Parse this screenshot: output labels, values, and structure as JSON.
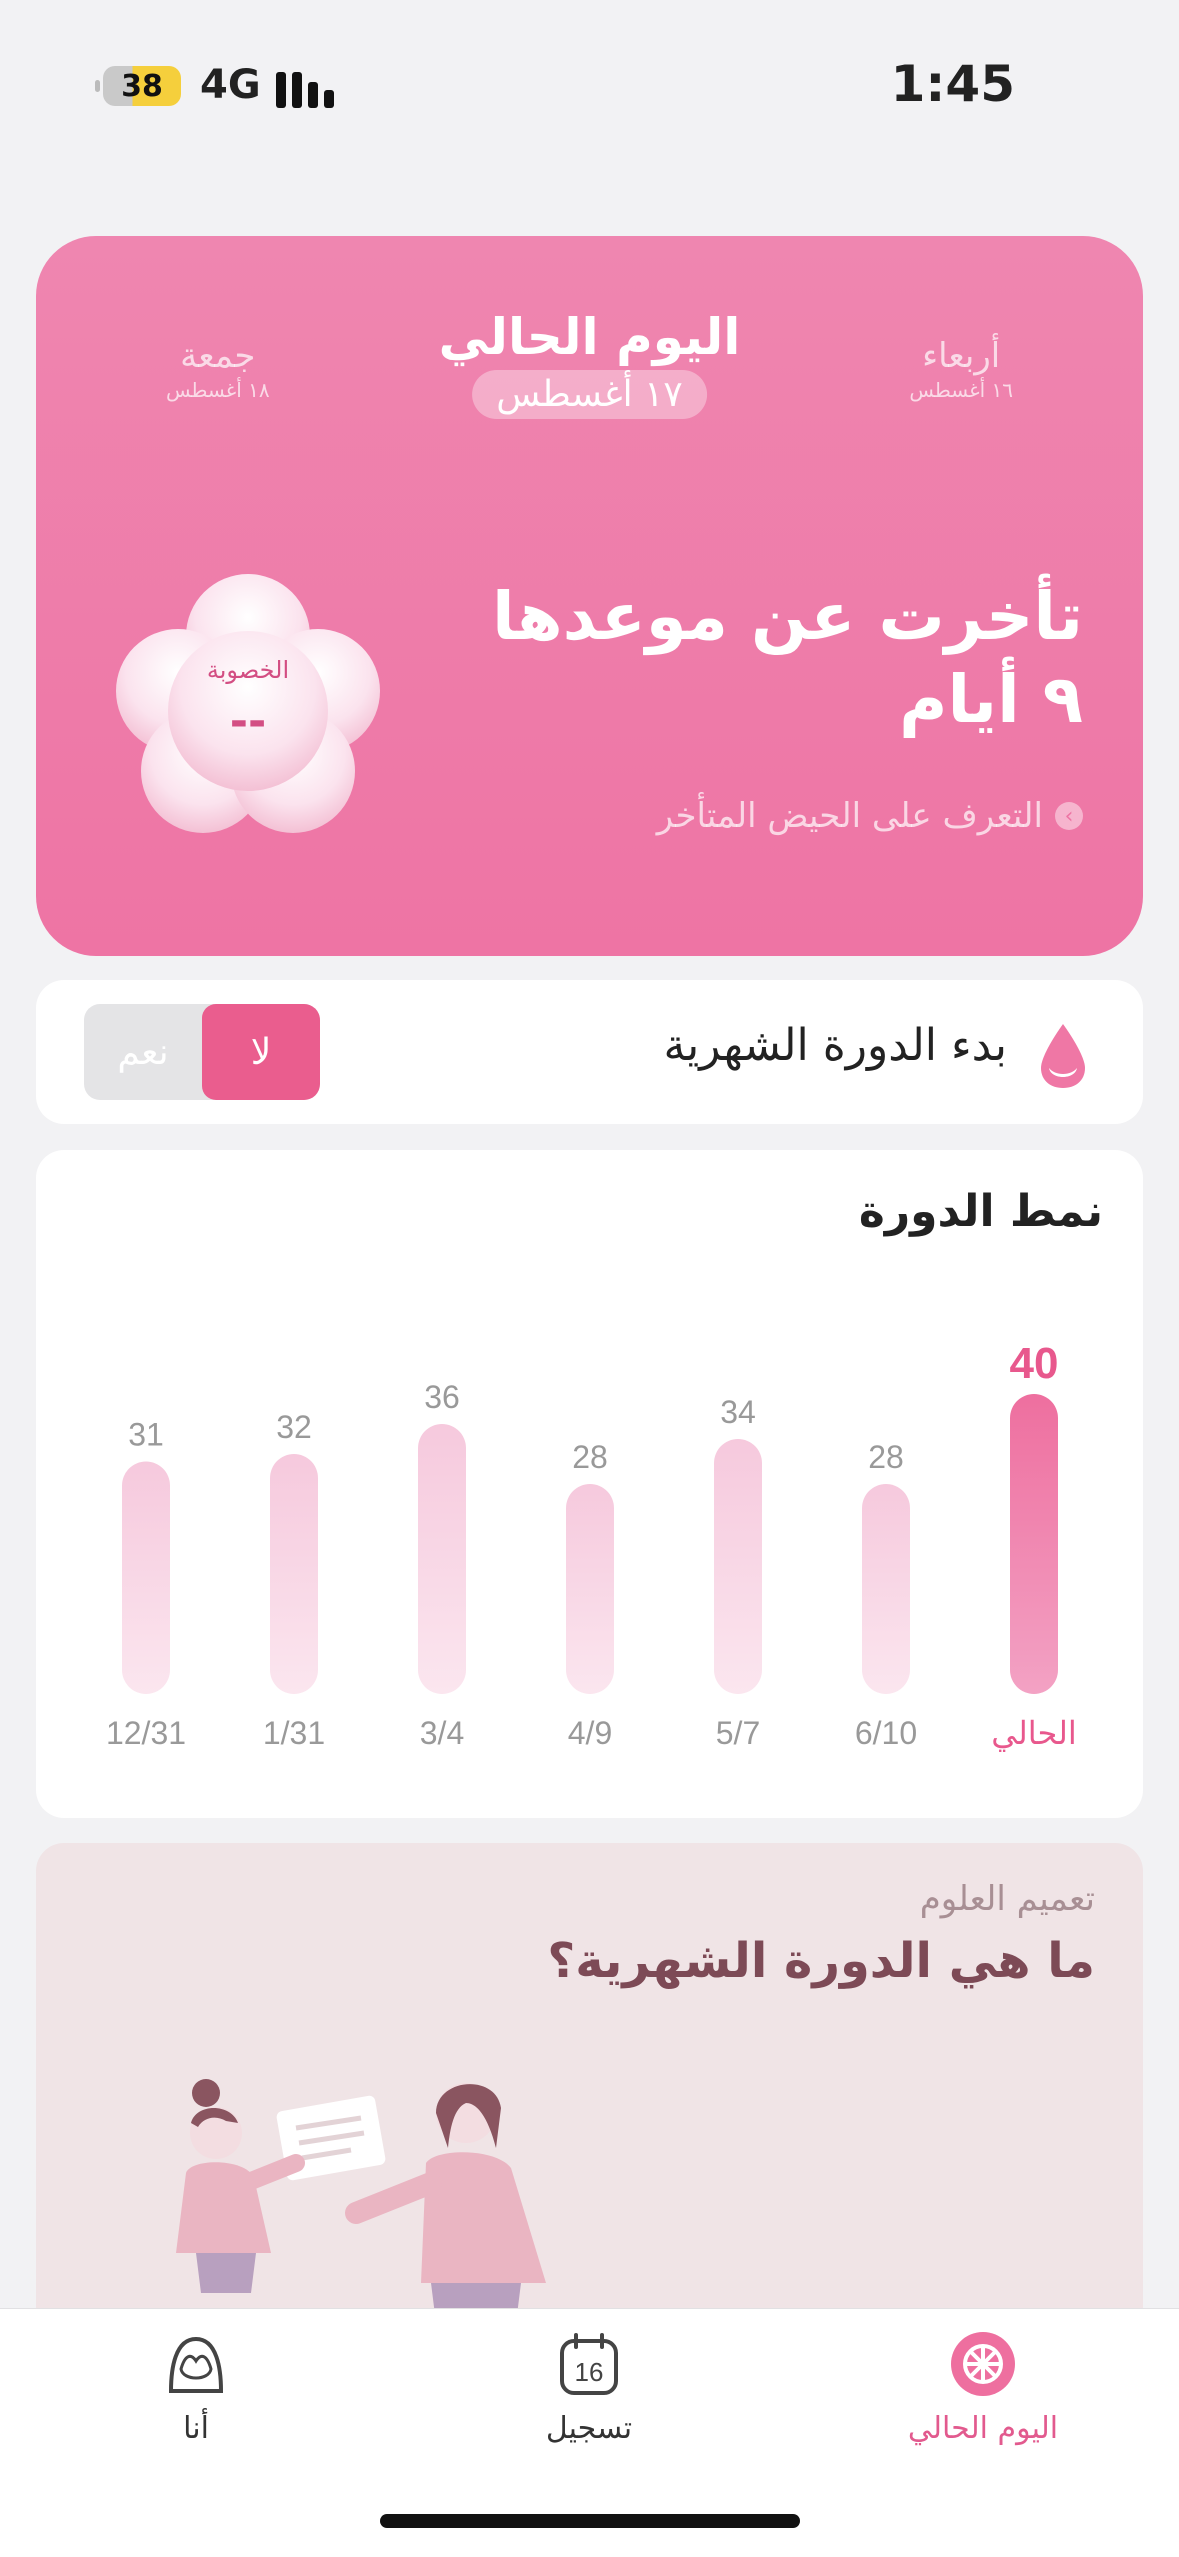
{
  "status_bar": {
    "battery": "38",
    "network": "4G",
    "time": "1:45"
  },
  "hero": {
    "prev_day": {
      "name": "جمعة",
      "date": "١٨ أغسطس"
    },
    "next_day": {
      "name": "أربعاء",
      "date": "١٦ أغسطس"
    },
    "today_title": "اليوم الحالي",
    "today_date": "١٧ أغسطس",
    "status_line1": "تأخرت عن موعدها",
    "status_line2": "٩ أيام",
    "learn_link": "التعرف على الحيض المتأخر",
    "fertility_label": "الخصوبة",
    "fertility_value": "--"
  },
  "period_start": {
    "label": "بدء الدورة الشهرية",
    "yes": "نعم",
    "no": "لا",
    "selected": "no"
  },
  "cycle_pattern": {
    "title": "نمط الدورة"
  },
  "chart_data": {
    "type": "bar",
    "categories": [
      "الحالي",
      "6/10",
      "5/7",
      "4/9",
      "3/4",
      "1/31",
      "12/31"
    ],
    "values": [
      40,
      28,
      34,
      28,
      36,
      32,
      31
    ],
    "highlight_index": 0,
    "ylim": [
      0,
      40
    ],
    "colors": {
      "highlight": "#ee6f9f",
      "normal": "#f6c9dd",
      "highlight_label": "#e8588d",
      "label": "#999999"
    }
  },
  "education": {
    "subtitle": "تعميم العلوم",
    "title": "ما هي الدورة الشهرية؟"
  },
  "tabs": [
    {
      "label": "اليوم الحالي",
      "icon": "flower-icon",
      "active": true
    },
    {
      "label": "تسجيل",
      "icon": "calendar-icon",
      "active": false
    },
    {
      "label": "أنا",
      "icon": "profile-icon",
      "active": false
    }
  ],
  "calendar_icon_day": "16",
  "colors": {
    "accent": "#ee74a4",
    "active_tab": "#e25a8e"
  }
}
